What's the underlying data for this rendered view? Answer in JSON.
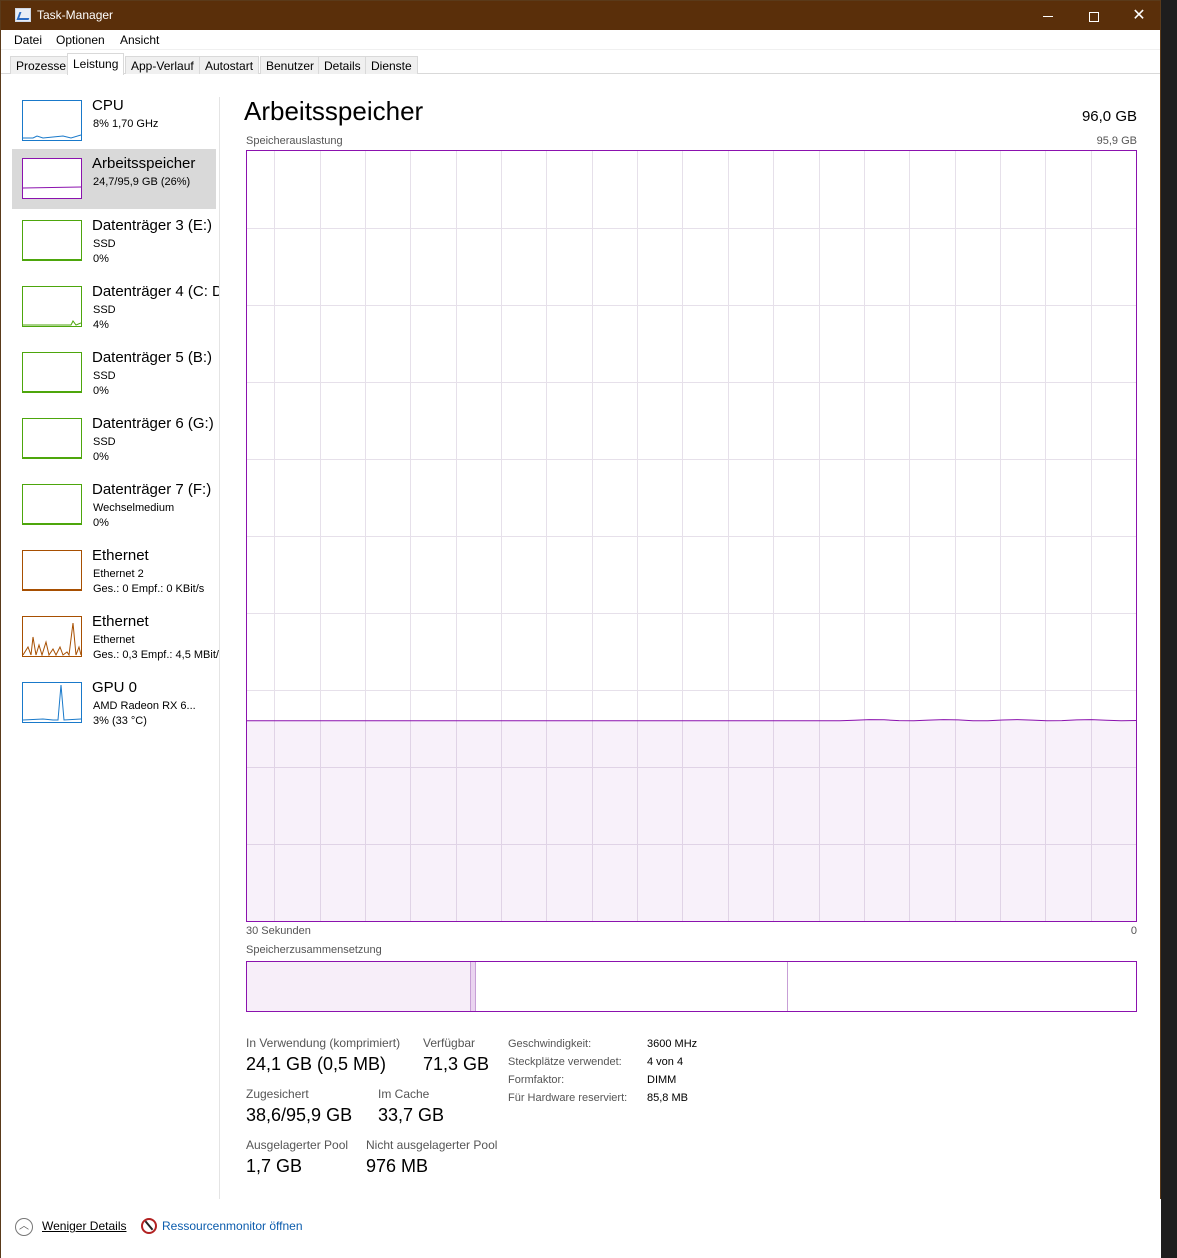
{
  "window": {
    "title": "Task-Manager"
  },
  "menu": [
    "Datei",
    "Optionen",
    "Ansicht"
  ],
  "tabs": [
    "Prozesse",
    "Leistung",
    "App-Verlauf",
    "Autostart",
    "Benutzer",
    "Details",
    "Dienste"
  ],
  "active_tab": "Leistung",
  "sidebar": {
    "items": [
      {
        "title": "CPU",
        "line1": "8%  1,70 GHz",
        "line2": "",
        "color": "#1979ca"
      },
      {
        "title": "Arbeitsspeicher",
        "line1": "24,7/95,9 GB (26%)",
        "line2": "",
        "color": "#8b12ae"
      },
      {
        "title": "Datenträger 3 (E:)",
        "line1": "SSD",
        "line2": "0%",
        "color": "#4da60c"
      },
      {
        "title": "Datenträger 4 (C: D",
        "line1": "SSD",
        "line2": "4%",
        "color": "#4da60c"
      },
      {
        "title": "Datenträger 5 (B:)",
        "line1": "SSD",
        "line2": "0%",
        "color": "#4da60c"
      },
      {
        "title": "Datenträger 6 (G:)",
        "line1": "SSD",
        "line2": "0%",
        "color": "#4da60c"
      },
      {
        "title": "Datenträger 7 (F:)",
        "line1": "Wechselmedium",
        "line2": "0%",
        "color": "#4da60c"
      },
      {
        "title": "Ethernet",
        "line1": "Ethernet 2",
        "line2": "Ges.: 0 Empf.: 0 KBit/s",
        "color": "#a74f01"
      },
      {
        "title": "Ethernet",
        "line1": "Ethernet",
        "line2": "Ges.: 0,3  Empf.: 4,5 MBit/s",
        "color": "#a74f01"
      },
      {
        "title": "GPU 0",
        "line1": "AMD Radeon RX 6...",
        "line2": "3% (33 °C)",
        "color": "#1979ca"
      }
    ]
  },
  "main": {
    "title": "Arbeitsspeicher",
    "total": "96,0 GB",
    "chart_label": "Speicherauslastung",
    "chart_max": "95,9 GB",
    "axis_left": "30 Sekunden",
    "axis_right": "0",
    "composition_label": "Speicherzusammensetzung",
    "stats": {
      "in_use_label": "In Verwendung (komprimiert)",
      "in_use_value": "24,1 GB (0,5 MB)",
      "available_label": "Verfügbar",
      "available_value": "71,3 GB",
      "committed_label": "Zugesichert",
      "committed_value": "38,6/95,9 GB",
      "cached_label": "Im Cache",
      "cached_value": "33,7 GB",
      "paged_label": "Ausgelagerter Pool",
      "paged_value": "1,7 GB",
      "nonpaged_label": "Nicht ausgelagerter Pool",
      "nonpaged_value": "976 MB"
    },
    "details": [
      {
        "label": "Geschwindigkeit:",
        "value": "3600 MHz"
      },
      {
        "label": "Steckplätze verwendet:",
        "value": "4 von 4"
      },
      {
        "label": "Formfaktor:",
        "value": "DIMM"
      },
      {
        "label": "Für Hardware reserviert:",
        "value": "85,8 MB"
      }
    ]
  },
  "footer": {
    "fewer_details": "Weniger Details",
    "resource_monitor": "Ressourcenmonitor öffnen"
  },
  "chart_data": {
    "type": "area",
    "ylim": [
      0,
      95.9
    ],
    "memory_usage_fraction": 0.26,
    "composition_fractions": {
      "in_use": 0.251,
      "modified": 0.005,
      "standby": 0.351,
      "free": 0.393
    }
  }
}
